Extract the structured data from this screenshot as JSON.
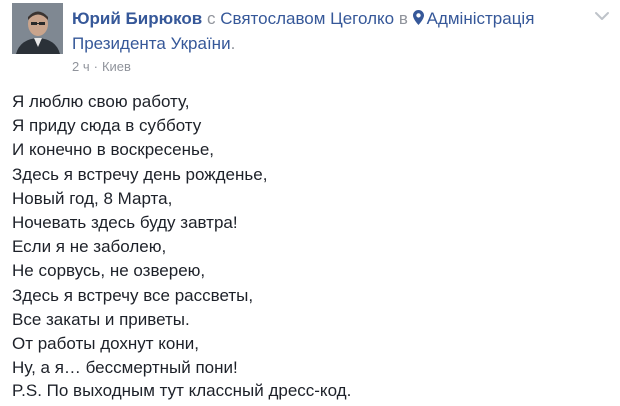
{
  "post": {
    "author": "Юрий Бирюков",
    "with_word": "с",
    "tagged": "Святославом Цеголко",
    "in_word": "в",
    "place_icon": "location-pin-icon",
    "place_line1": "Адміністрація",
    "place_line2": "Президента України",
    "place_end": ".",
    "time": "2 ч",
    "separator": "·",
    "location": "Киев",
    "menu_icon": "chevron-down-icon",
    "lines": [
      "Я люблю свою работу,",
      "Я приду сюда в субботу",
      "И конечно в воскресенье,",
      "Здесь я встречу день рожденье,",
      "Новый год, 8 Марта,",
      "Ночевать здесь буду завтра!",
      "Если я не заболею,",
      "Не сорвусь, не озверею,",
      "Здесь я встречу все рассветы,",
      "Все закаты и приветы.",
      "От работы дохнут кони,",
      "Ну, а я… бессмертный пони!"
    ],
    "ps": "P.S. По выходным тут классный дресс-код."
  },
  "colors": {
    "link": "#365899",
    "text": "#1d2129",
    "meta": "#90949c"
  }
}
